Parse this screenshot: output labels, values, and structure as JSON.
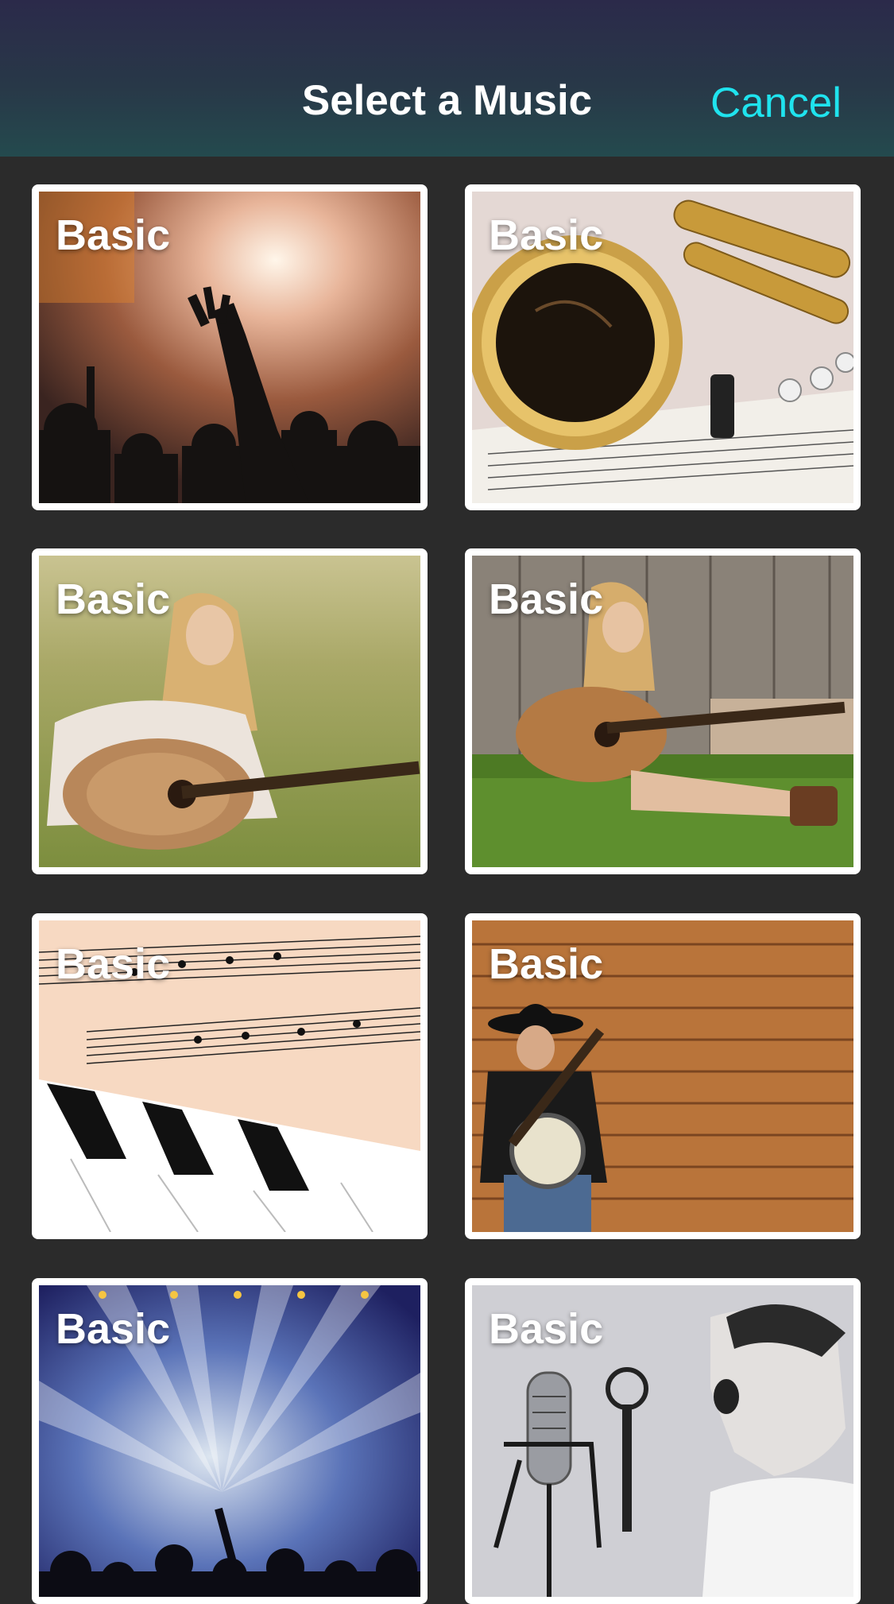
{
  "header": {
    "title": "Select a Music",
    "cancel_label": "Cancel"
  },
  "grid": {
    "items": [
      {
        "label": "Basic",
        "image": "concert-crowd-image"
      },
      {
        "label": "Basic",
        "image": "saxophone-image"
      },
      {
        "label": "Basic",
        "image": "girl-guitar-field-image"
      },
      {
        "label": "Basic",
        "image": "girl-guitar-fence-image"
      },
      {
        "label": "Basic",
        "image": "sheet-music-piano-image"
      },
      {
        "label": "Basic",
        "image": "banjo-player-image"
      },
      {
        "label": "Basic",
        "image": "stage-lights-image"
      },
      {
        "label": "Basic",
        "image": "boy-singing-microphone-image"
      }
    ]
  },
  "colors": {
    "accent": "#1fe3ee",
    "background": "#2b2b2b",
    "card_border": "#ffffff"
  }
}
